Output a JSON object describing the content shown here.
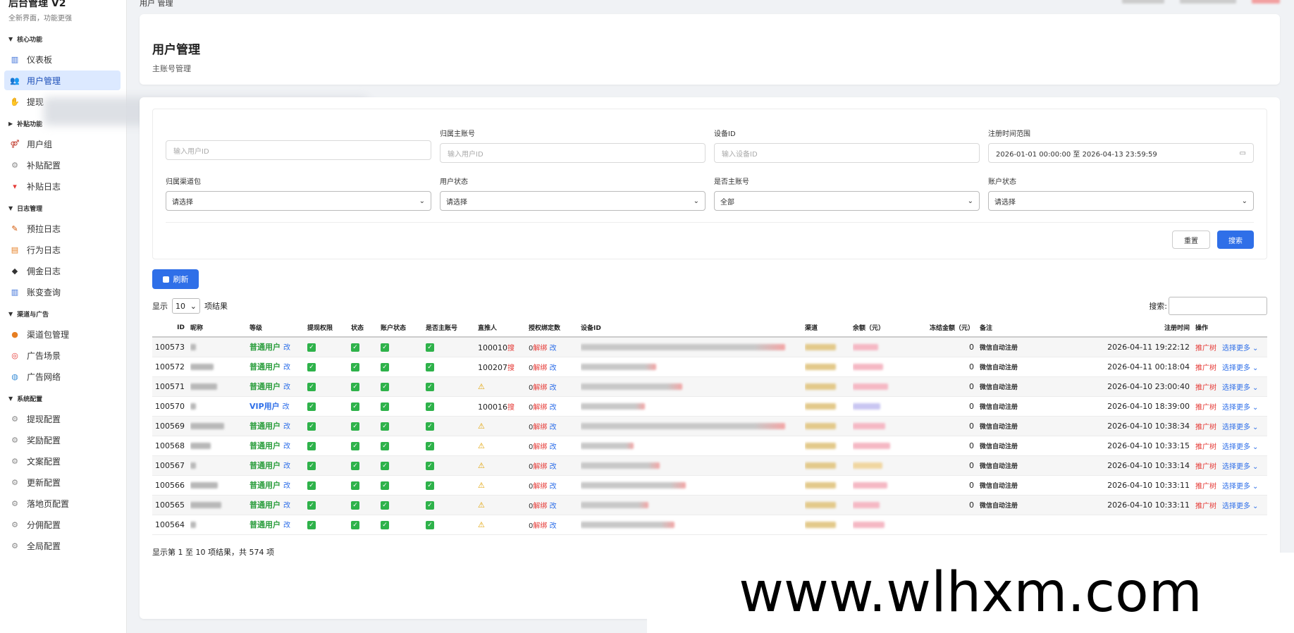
{
  "brand": {
    "title": "后台管理 V2",
    "subtitle": "全新界面，功能更强"
  },
  "topbar": {
    "crumb": "用户 管理"
  },
  "sidebar": {
    "groups": [
      {
        "label": "核心功能",
        "items": [
          {
            "label": "仪表板",
            "icon": "chart-icon"
          },
          {
            "label": "用户管理",
            "icon": "users-icon"
          },
          {
            "label": "提现",
            "icon": "hand-icon"
          }
        ]
      },
      {
        "label": "补贴功能",
        "items": [
          {
            "label": "用户组",
            "icon": "people-icon"
          },
          {
            "label": "补贴配置",
            "icon": "gear-icon"
          },
          {
            "label": "补贴日志",
            "icon": "gift-icon"
          }
        ]
      },
      {
        "label": "日志管理",
        "items": [
          {
            "label": "预拉日志",
            "icon": "pencil-icon"
          },
          {
            "label": "行为日志",
            "icon": "clipboard-icon"
          },
          {
            "label": "佣金日志",
            "icon": "diamond-icon"
          },
          {
            "label": "账变查询",
            "icon": "chart-icon"
          }
        ]
      },
      {
        "label": "渠道与广告",
        "items": [
          {
            "label": "渠道包管理",
            "icon": "package-icon"
          },
          {
            "label": "广告场景",
            "icon": "target-icon"
          },
          {
            "label": "广告网络",
            "icon": "globe-icon"
          }
        ]
      },
      {
        "label": "系统配置",
        "items": [
          {
            "label": "提现配置",
            "icon": "gear-icon"
          },
          {
            "label": "奖励配置",
            "icon": "gear-icon"
          },
          {
            "label": "文案配置",
            "icon": "gear-icon"
          },
          {
            "label": "更新配置",
            "icon": "gear-icon"
          },
          {
            "label": "落地页配置",
            "icon": "gear-icon"
          },
          {
            "label": "分佣配置",
            "icon": "gear-icon"
          },
          {
            "label": "全局配置",
            "icon": "gear-icon"
          }
        ]
      }
    ]
  },
  "header": {
    "title": "用户管理",
    "subtitle": "主账号管理"
  },
  "filters": {
    "row1": [
      {
        "label": "",
        "placeholder": "输入用户ID"
      },
      {
        "label": "归属主账号",
        "placeholder": "输入用户ID"
      },
      {
        "label": "设备ID",
        "placeholder": "输入设备ID"
      },
      {
        "label": "注册时间范围",
        "value": "2026-01-01 00:00:00 至 2026-04-13 23:59:59"
      }
    ],
    "row2": [
      {
        "label": "归属渠道包",
        "value": "请选择"
      },
      {
        "label": "用户状态",
        "value": "请选择"
      },
      {
        "label": "是否主账号",
        "value": "全部"
      },
      {
        "label": "账户状态",
        "value": "请选择"
      }
    ],
    "reset": "重置",
    "search": "搜索"
  },
  "refresh": "刷新",
  "table": {
    "show": "显示",
    "page_len": "10",
    "results": "项结果",
    "search_label": "搜索:",
    "columns": [
      "ID",
      "昵称",
      "等级",
      "提现权限",
      "状态",
      "账户状态",
      "是否主账号",
      "直推人",
      "授权绑定数",
      "设备ID",
      "渠道",
      "余额（元）",
      "冻结金额（元）",
      "备注",
      "注册时间",
      "操作"
    ],
    "rows": [
      {
        "id": "100573",
        "level": "普通用户",
        "vip": false,
        "ref": "100010",
        "time": "2026-04-11 19:22:12",
        "frozen": "0",
        "note": "微信自动注册"
      },
      {
        "id": "100572",
        "level": "普通用户",
        "vip": false,
        "ref": "100207",
        "time": "2026-04-11 00:18:04",
        "frozen": "0",
        "note": "微信自动注册"
      },
      {
        "id": "100571",
        "level": "普通用户",
        "vip": false,
        "ref": "",
        "time": "2026-04-10 23:00:40",
        "frozen": "0",
        "note": "微信自动注册"
      },
      {
        "id": "100570",
        "level": "VIP用户",
        "vip": true,
        "ref": "100016",
        "time": "2026-04-10 18:39:00",
        "frozen": "0",
        "note": "微信自动注册"
      },
      {
        "id": "100569",
        "level": "普通用户",
        "vip": false,
        "ref": "",
        "time": "2026-04-10 10:38:34",
        "frozen": "0",
        "note": "微信自动注册"
      },
      {
        "id": "100568",
        "level": "普通用户",
        "vip": false,
        "ref": "",
        "time": "2026-04-10 10:33:15",
        "frozen": "0",
        "note": "微信自动注册"
      },
      {
        "id": "100567",
        "level": "普通用户",
        "vip": false,
        "ref": "",
        "time": "2026-04-10 10:33:14",
        "frozen": "0",
        "note": "微信自动注册"
      },
      {
        "id": "100566",
        "level": "普通用户",
        "vip": false,
        "ref": "",
        "time": "2026-04-10 10:33:11",
        "frozen": "0",
        "note": "微信自动注册"
      },
      {
        "id": "100565",
        "level": "普通用户",
        "vip": false,
        "ref": "",
        "time": "2026-04-10 10:33:11",
        "frozen": "0",
        "note": "微信自动注册"
      },
      {
        "id": "100564",
        "level": "普通用户",
        "vip": false,
        "ref": "",
        "time": "",
        "frozen": "",
        "note": ""
      }
    ],
    "edit": "改",
    "ref_mark": "搜",
    "unbind_zero": "0",
    "unbind": "解绑",
    "unbind_edit": "改",
    "op_tree": "推广树",
    "op_more": "选择更多",
    "footer": "显示第 1 至 10 项结果，共 574 项"
  },
  "watermark": "www.wlhxm.com"
}
